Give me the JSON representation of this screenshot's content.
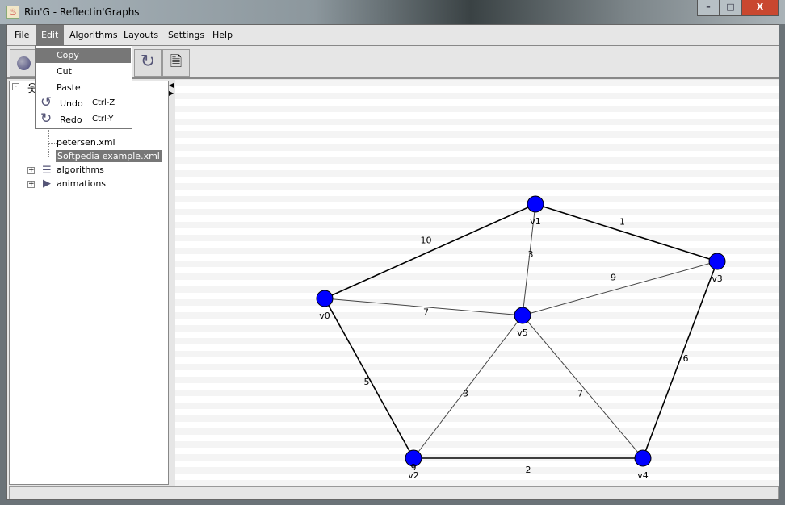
{
  "window": {
    "title": "Rin'G - Reflectin'Graphs",
    "minimize": "–",
    "maximize": "□",
    "close": "X"
  },
  "menubar": [
    "File",
    "Edit",
    "Algorithms",
    "Layouts",
    "Settings",
    "Help"
  ],
  "edit_menu": [
    {
      "label": "Copy",
      "shortcut": "",
      "icon": ""
    },
    {
      "label": "Cut",
      "shortcut": "",
      "icon": ""
    },
    {
      "label": "Paste",
      "shortcut": "",
      "icon": ""
    },
    {
      "label": "Undo",
      "shortcut": "Ctrl-Z",
      "icon": "undo-icon"
    },
    {
      "label": "Redo",
      "shortcut": "Ctrl-Y",
      "icon": "redo-icon"
    }
  ],
  "tree": {
    "files": [
      "petersen.xml",
      "Softpedia example.xml"
    ],
    "folders": [
      "algorithms",
      "animations"
    ]
  },
  "graph": {
    "node_color": "#0000ff",
    "nodes": [
      "v0",
      "v1",
      "v2",
      "v3",
      "v4",
      "v5"
    ],
    "edges": [
      {
        "from": "v0",
        "to": "v1",
        "weight": "10"
      },
      {
        "from": "v1",
        "to": "v3",
        "weight": "1"
      },
      {
        "from": "v1",
        "to": "v5",
        "weight": "3"
      },
      {
        "from": "v0",
        "to": "v5",
        "weight": "7"
      },
      {
        "from": "v5",
        "to": "v3",
        "weight": "9"
      },
      {
        "from": "v0",
        "to": "v2",
        "weight": "5"
      },
      {
        "from": "v5",
        "to": "v2",
        "weight": "3"
      },
      {
        "from": "v5",
        "to": "v4",
        "weight": "7"
      },
      {
        "from": "v3",
        "to": "v4",
        "weight": "6"
      },
      {
        "from": "v2",
        "to": "v4",
        "weight": "2"
      }
    ],
    "stray_label": "9"
  }
}
